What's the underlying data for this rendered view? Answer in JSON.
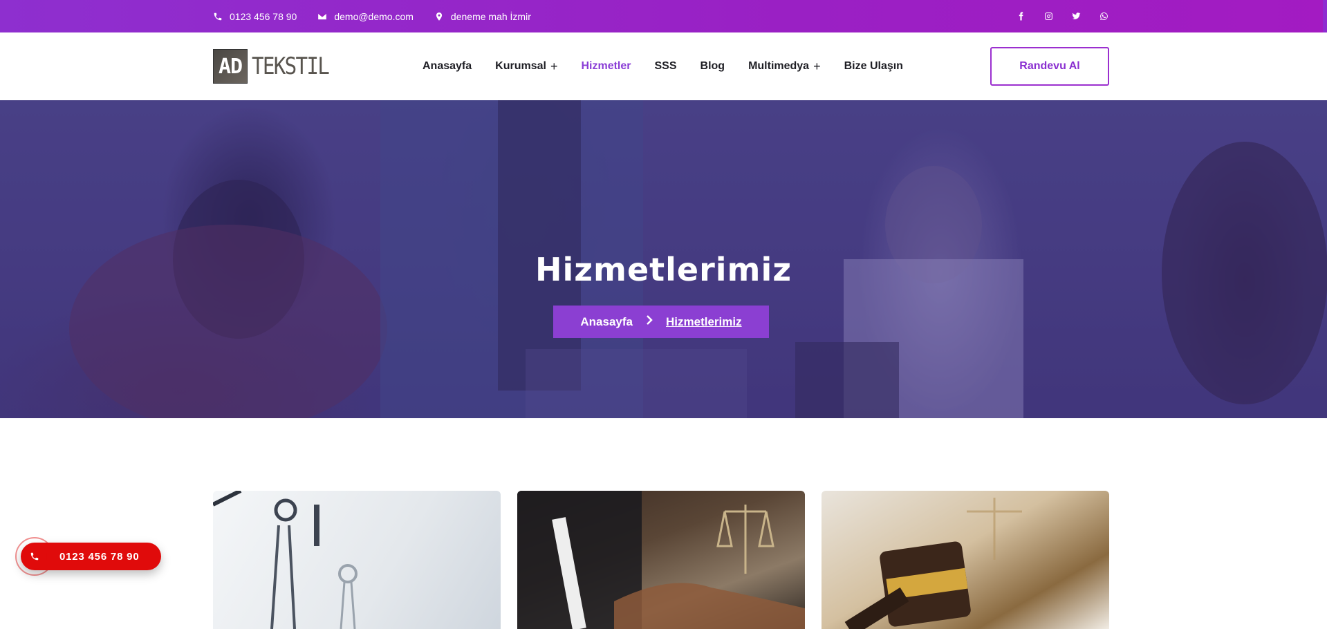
{
  "topbar": {
    "phone": "0123 456 78 90",
    "email": "demo@demo.com",
    "address": "deneme mah İzmir",
    "socials": [
      "facebook-icon",
      "instagram-icon",
      "twitter-icon",
      "whatsapp-icon"
    ]
  },
  "header": {
    "logo_ad": "AD",
    "logo_tekstil": "TEKSTIL",
    "nav": [
      {
        "label": "Anasayfa",
        "has_submenu": false,
        "active": false
      },
      {
        "label": "Kurumsal",
        "has_submenu": true,
        "active": false
      },
      {
        "label": "Hizmetler",
        "has_submenu": false,
        "active": true
      },
      {
        "label": "SSS",
        "has_submenu": false,
        "active": false
      },
      {
        "label": "Blog",
        "has_submenu": false,
        "active": false
      },
      {
        "label": "Multimedya",
        "has_submenu": true,
        "active": false
      },
      {
        "label": "Bize Ulaşın",
        "has_submenu": false,
        "active": false
      }
    ],
    "cta_label": "Randevu Al"
  },
  "hero": {
    "title": "Hizmetlerimiz",
    "breadcrumb": {
      "home": "Anasayfa",
      "current": "Hizmetlerimiz"
    }
  },
  "floating_call": {
    "phone": "0123 456 78 90"
  },
  "colors": {
    "accent": "#8b3fd2",
    "topbar": "#9a20c4",
    "call_button": "#e00b0b"
  }
}
